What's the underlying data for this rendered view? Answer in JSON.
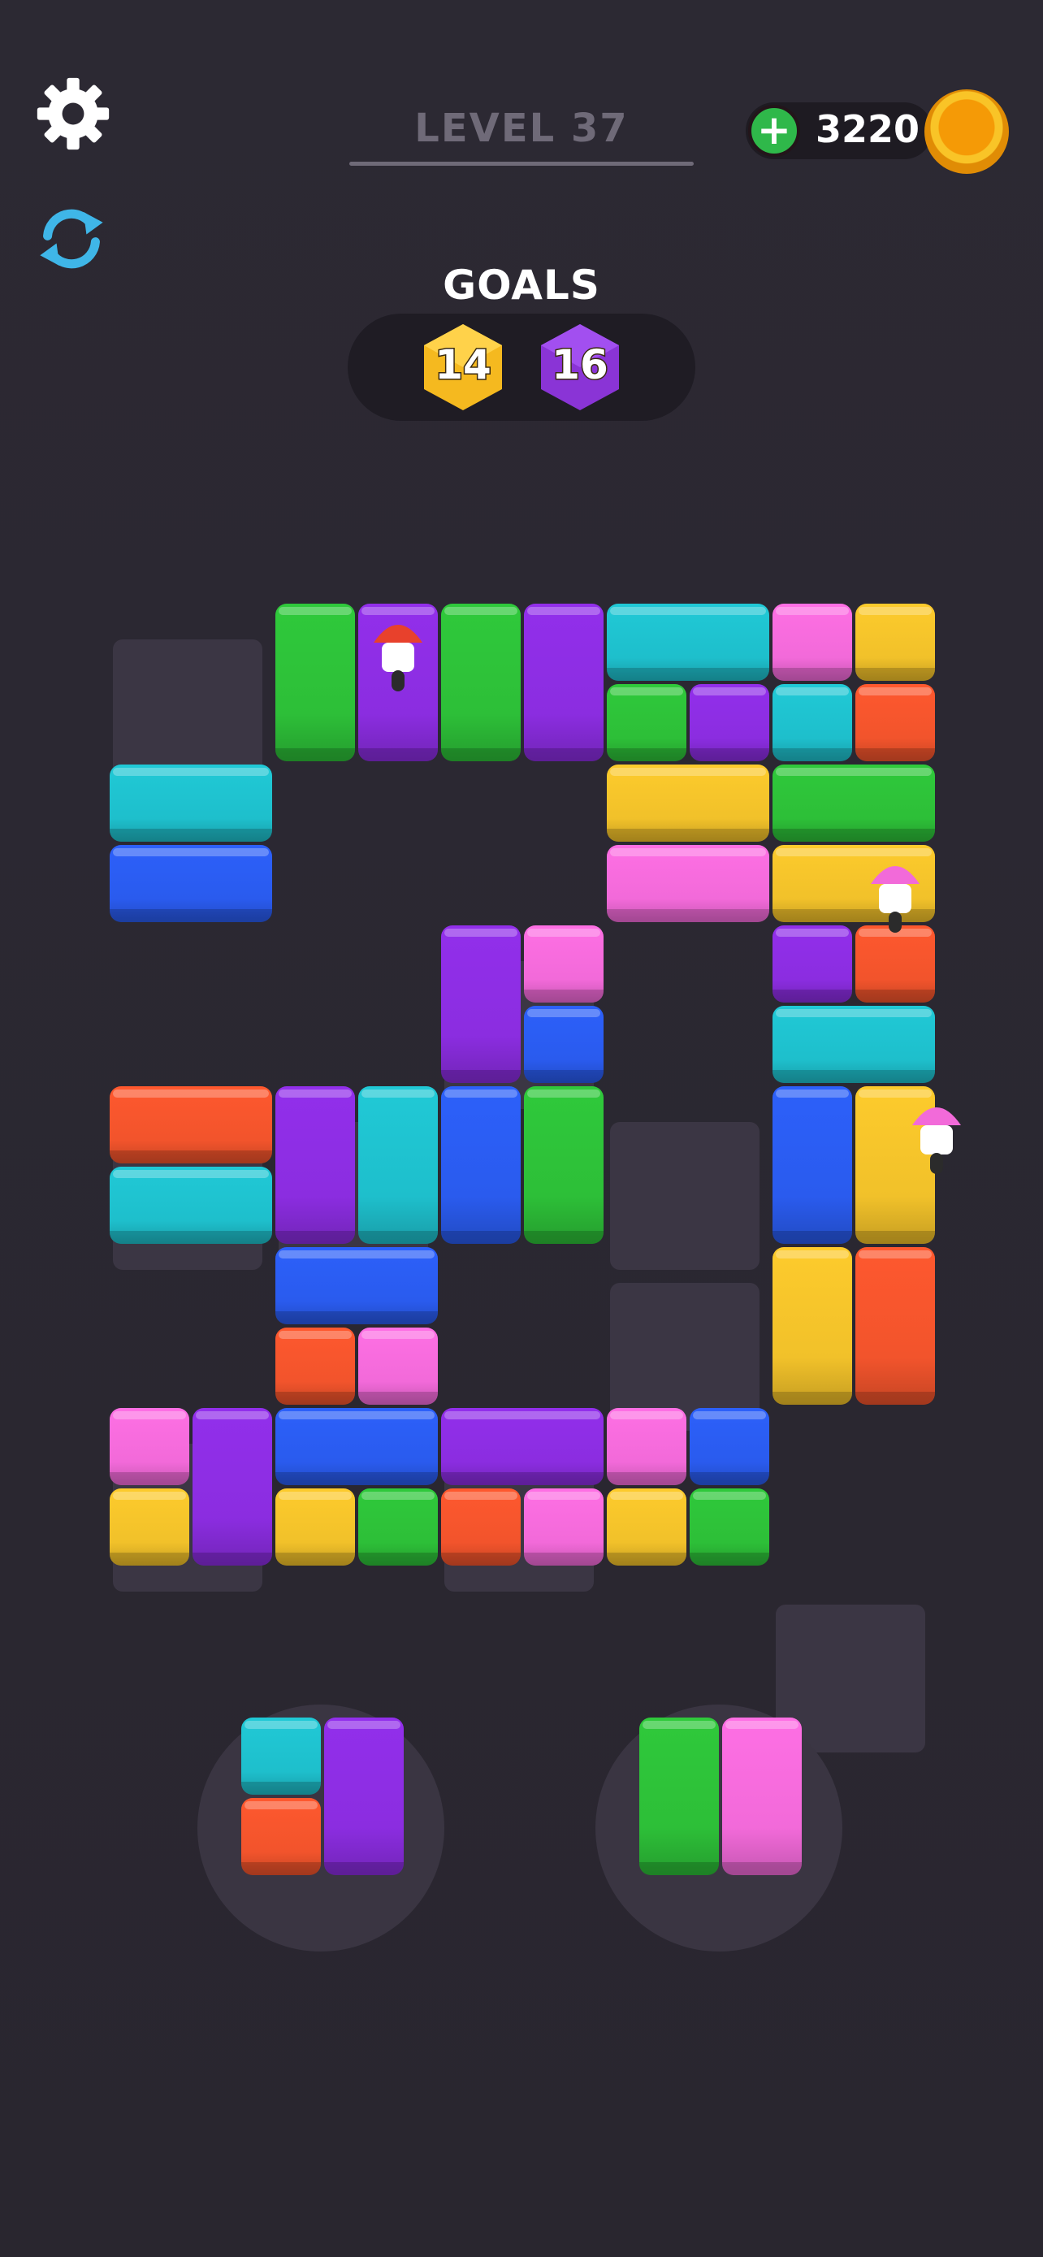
{
  "header": {
    "level_label": "LEVEL 37",
    "coin_count": "3220",
    "add_coins_symbol": "+"
  },
  "goals": {
    "title": "GOALS",
    "items": [
      {
        "count": "14",
        "color": "yellow"
      },
      {
        "count": "16",
        "color": "purple"
      }
    ]
  },
  "colors": {
    "green": "#2dbf38",
    "purple": "#8b2de0",
    "cyan": "#1ebfcc",
    "pink": "#f26ad9",
    "yellow": "#f1c12a",
    "orange": "#f2542c",
    "blue": "#2a5bee",
    "empty_cell": "#3b3644",
    "background": "#2b2832",
    "refresh_icon": "#3fb6e8"
  },
  "board": {
    "rows": 7,
    "cols": 10,
    "empty_cells": [
      [
        0,
        0
      ],
      [
        2,
        4
      ],
      [
        3,
        0
      ],
      [
        3,
        2
      ],
      [
        3,
        6
      ],
      [
        4,
        6
      ],
      [
        5,
        0
      ],
      [
        5,
        4
      ],
      [
        6,
        8
      ]
    ],
    "blocks": [
      {
        "color": "green",
        "row": 0,
        "col": 2,
        "rows": 1,
        "cols": 1
      },
      {
        "color": "purple",
        "row": 0,
        "col": 3,
        "rows": 1,
        "cols": 1
      },
      {
        "color": "green",
        "row": 0,
        "col": 4,
        "rows": 1,
        "cols": 1
      },
      {
        "color": "purple",
        "row": 0,
        "col": 5,
        "rows": 1,
        "cols": 1
      },
      {
        "color": "cyan",
        "row": 0,
        "col": 6,
        "rows": 0.5,
        "cols": 2
      },
      {
        "color": "green",
        "row": 0.5,
        "col": 6,
        "rows": 0.5,
        "cols": 1
      },
      {
        "color": "purple",
        "row": 0.5,
        "col": 7,
        "rows": 0.5,
        "cols": 1
      },
      {
        "color": "pink",
        "row": 0,
        "col": 8,
        "rows": 0.5,
        "cols": 1
      },
      {
        "color": "yellow",
        "row": 0,
        "col": 9,
        "rows": 0.5,
        "cols": 1
      },
      {
        "color": "cyan",
        "row": 0.5,
        "col": 8,
        "rows": 0.5,
        "cols": 1
      },
      {
        "color": "orange",
        "row": 0.5,
        "col": 9,
        "rows": 0.5,
        "cols": 1
      },
      {
        "color": "cyan",
        "row": 1,
        "col": 0,
        "rows": 0.5,
        "cols": 2
      },
      {
        "color": "blue",
        "row": 1.5,
        "col": 0,
        "rows": 0.5,
        "cols": 2
      },
      {
        "color": "yellow",
        "row": 1,
        "col": 6,
        "rows": 0.5,
        "cols": 2
      },
      {
        "color": "pink",
        "row": 1.5,
        "col": 6,
        "rows": 0.5,
        "cols": 2
      },
      {
        "color": "green",
        "row": 1,
        "col": 8,
        "rows": 0.5,
        "cols": 2
      },
      {
        "color": "yellow",
        "row": 1.5,
        "col": 8,
        "rows": 0.5,
        "cols": 2
      },
      {
        "color": "purple",
        "row": 2,
        "col": 4,
        "rows": 1,
        "cols": 1
      },
      {
        "color": "pink",
        "row": 2,
        "col": 5,
        "rows": 0.5,
        "cols": 1
      },
      {
        "color": "blue",
        "row": 2.5,
        "col": 5,
        "rows": 0.5,
        "cols": 1
      },
      {
        "color": "purple",
        "row": 2,
        "col": 8,
        "rows": 0.5,
        "cols": 1
      },
      {
        "color": "orange",
        "row": 2,
        "col": 9,
        "rows": 0.5,
        "cols": 1
      },
      {
        "color": "cyan",
        "row": 2.5,
        "col": 8,
        "rows": 0.5,
        "cols": 2
      },
      {
        "color": "orange",
        "row": 3,
        "col": 0,
        "rows": 0.5,
        "cols": 2
      },
      {
        "color": "cyan",
        "row": 3.5,
        "col": 0,
        "rows": 0.5,
        "cols": 2
      },
      {
        "color": "purple",
        "row": 3,
        "col": 2,
        "rows": 1,
        "cols": 1
      },
      {
        "color": "cyan",
        "row": 3,
        "col": 3,
        "rows": 1,
        "cols": 1
      },
      {
        "color": "blue",
        "row": 3,
        "col": 4,
        "rows": 1,
        "cols": 1
      },
      {
        "color": "green",
        "row": 3,
        "col": 5,
        "rows": 1,
        "cols": 1
      },
      {
        "color": "blue",
        "row": 3,
        "col": 8,
        "rows": 1,
        "cols": 1
      },
      {
        "color": "yellow",
        "row": 3,
        "col": 9,
        "rows": 1,
        "cols": 1
      },
      {
        "color": "blue",
        "row": 4,
        "col": 2,
        "rows": 0.5,
        "cols": 2
      },
      {
        "color": "orange",
        "row": 4.5,
        "col": 2,
        "rows": 0.5,
        "cols": 1
      },
      {
        "color": "pink",
        "row": 4.5,
        "col": 3,
        "rows": 0.5,
        "cols": 1
      },
      {
        "color": "yellow",
        "row": 4,
        "col": 8,
        "rows": 1,
        "cols": 1
      },
      {
        "color": "orange",
        "row": 4,
        "col": 9,
        "rows": 1,
        "cols": 1
      },
      {
        "color": "pink",
        "row": 5,
        "col": 0,
        "rows": 0.5,
        "cols": 1
      },
      {
        "color": "yellow",
        "row": 5.5,
        "col": 0,
        "rows": 0.5,
        "cols": 1
      },
      {
        "color": "purple",
        "row": 5,
        "col": 1,
        "rows": 1,
        "cols": 1
      },
      {
        "color": "blue",
        "row": 5,
        "col": 2,
        "rows": 0.5,
        "cols": 2
      },
      {
        "color": "yellow",
        "row": 5.5,
        "col": 2,
        "rows": 0.5,
        "cols": 1
      },
      {
        "color": "green",
        "row": 5.5,
        "col": 3,
        "rows": 0.5,
        "cols": 1
      },
      {
        "color": "purple",
        "row": 5,
        "col": 4,
        "rows": 0.5,
        "cols": 2
      },
      {
        "color": "orange",
        "row": 5.5,
        "col": 4,
        "rows": 0.5,
        "cols": 1
      },
      {
        "color": "pink",
        "row": 5.5,
        "col": 5,
        "rows": 0.5,
        "cols": 1
      },
      {
        "color": "pink",
        "row": 5,
        "col": 6,
        "rows": 0.5,
        "cols": 1
      },
      {
        "color": "blue",
        "row": 5,
        "col": 7,
        "rows": 0.5,
        "cols": 1
      },
      {
        "color": "yellow",
        "row": 5.5,
        "col": 6,
        "rows": 0.5,
        "cols": 1
      },
      {
        "color": "green",
        "row": 5.5,
        "col": 7,
        "rows": 0.5,
        "cols": 1
      }
    ],
    "lamps": [
      {
        "color": "red",
        "row": 0,
        "col": 3
      },
      {
        "color": "pink",
        "row": 1.5,
        "col": 9
      },
      {
        "color": "pink",
        "row": 3,
        "col": 9.5
      }
    ]
  },
  "trays": [
    {
      "pieces": [
        {
          "color": "cyan",
          "row": 0,
          "col": 0,
          "rows": 0.5,
          "cols": 1
        },
        {
          "color": "orange",
          "row": 0.5,
          "col": 0,
          "rows": 0.5,
          "cols": 1
        },
        {
          "color": "purple",
          "row": 0,
          "col": 1,
          "rows": 1,
          "cols": 1
        }
      ]
    },
    {
      "pieces": [
        {
          "color": "green",
          "row": 0,
          "col": 0,
          "rows": 1,
          "cols": 1
        },
        {
          "color": "pink",
          "row": 0,
          "col": 1,
          "rows": 1,
          "cols": 1
        }
      ]
    }
  ]
}
